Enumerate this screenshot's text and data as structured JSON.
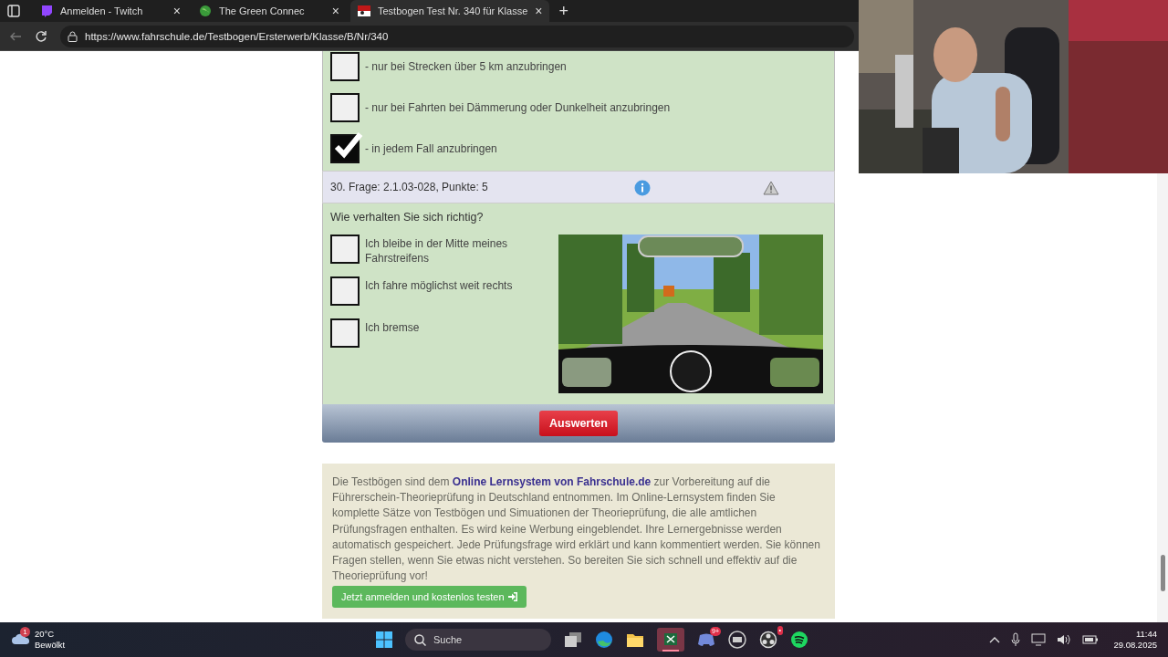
{
  "browser": {
    "tabs": [
      {
        "title": "Anmelden - Twitch",
        "selected": false,
        "kind": "twitch",
        "close": "×"
      },
      {
        "title": "The Green Connec",
        "selected": false,
        "kind": "globe",
        "close": "×"
      },
      {
        "title": "Testbogen Test Nr. 340 für Klasse",
        "selected": true,
        "kind": "site",
        "close": "×"
      }
    ],
    "new_tab": "+",
    "url": "https://www.fahrschule.de/Testbogen/Ersterwerb/Klasse/B/Nr/340"
  },
  "previous_question": {
    "answers": [
      {
        "text": "- nur bei Strecken über 5 km anzubringen",
        "checked": false
      },
      {
        "text": "- nur bei Fahrten bei Dämmerung oder Dunkelheit anzubringen",
        "checked": false
      },
      {
        "text": "- in jedem Fall anzubringen",
        "checked": true
      }
    ]
  },
  "question": {
    "header": "30. Frage: 2.1.03-028, Punkte: 5",
    "prompt": "Wie verhalten Sie sich richtig?",
    "answers": [
      {
        "text": "Ich bleibe in der Mitte meines Fahrstreifens",
        "checked": false
      },
      {
        "text": "Ich fahre möglichst weit rechts",
        "checked": false
      },
      {
        "text": "Ich bremse",
        "checked": false
      }
    ]
  },
  "submit_button": "Auswerten",
  "info_box": {
    "text_before": "Die Testbögen sind dem",
    "link": "Online Lernsystem von Fahrschule.de",
    "text_after": "zur Vorbereitung auf die Führerschein-Theorieprüfung in Deutschland entnommen. Im Online-Lernsystem finden Sie komplette Sätze von Testbögen und Simuationen der Theorieprüfung, die alle amtlichen Prüfungsfragen enthalten. Es wird keine Werbung eingeblendet. Ihre Lernergebnisse werden automatisch gespeichert. Jede Prüfungsfrage wird erklärt und kann kommentiert werden. Sie können Fragen stellen, wenn Sie etwas nicht verstehen. So bereiten Sie sich schnell und effektiv auf die Theorieprüfung vor!",
    "button": "Jetzt anmelden und kostenlos testen"
  },
  "taskbar": {
    "weather": {
      "temperature": "20°C",
      "condition": "Bewölkt",
      "badge": "1"
    },
    "search_placeholder": "Suche",
    "apps": [
      {
        "kind": "taskview"
      },
      {
        "kind": "edge"
      },
      {
        "kind": "folder"
      },
      {
        "kind": "excel"
      },
      {
        "kind": "discord",
        "badge": "9+"
      },
      {
        "kind": "keyboard"
      },
      {
        "kind": "obs",
        "badge": "•"
      },
      {
        "kind": "spotify"
      }
    ],
    "time": "11:44",
    "date": "29.08.2025"
  }
}
